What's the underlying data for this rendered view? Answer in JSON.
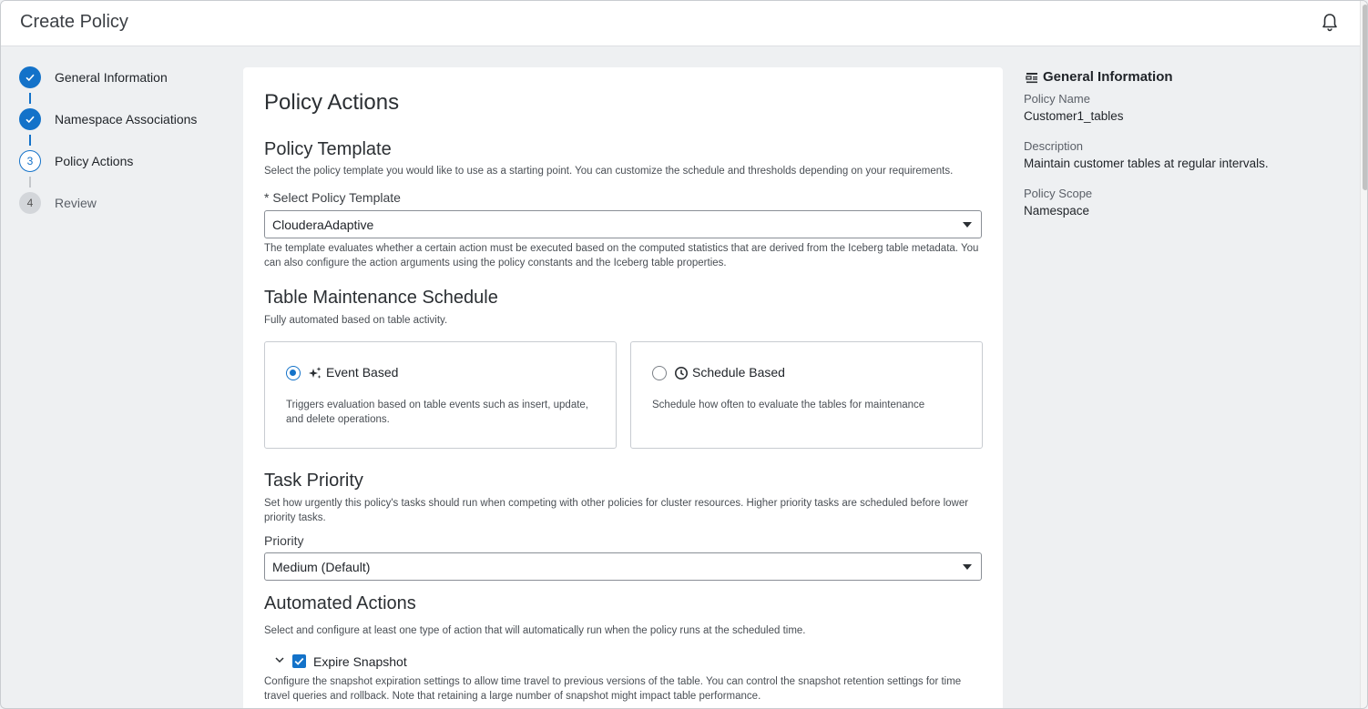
{
  "header": {
    "title": "Create Policy",
    "icons": [
      "bell-icon"
    ]
  },
  "stepper": {
    "steps": [
      {
        "number": "1",
        "label": "General Information",
        "state": "done"
      },
      {
        "number": "2",
        "label": "Namespace Associations",
        "state": "done"
      },
      {
        "number": "3",
        "label": "Policy Actions",
        "state": "active"
      },
      {
        "number": "4",
        "label": "Review",
        "state": "todo"
      }
    ]
  },
  "main": {
    "title": "Policy Actions",
    "template": {
      "heading": "Policy Template",
      "description": "Select the policy template you would like to use as a starting point. You can customize the schedule and thresholds depending on your requirements.",
      "required_marker": "*",
      "field_label": "Select Policy Template",
      "value": "ClouderaAdaptive",
      "help": "The template evaluates whether a certain action must be executed based on the computed statistics that are derived from the Iceberg table metadata. You can also configure the action arguments using the policy constants and the Iceberg table properties."
    },
    "schedule": {
      "heading": "Table Maintenance Schedule",
      "description": "Fully automated based on table activity.",
      "options": [
        {
          "title": "Event Based",
          "icon": "sparkle-icon",
          "selected": true,
          "description": "Triggers evaluation based on table events such as insert, update, and delete operations."
        },
        {
          "title": "Schedule Based",
          "icon": "clock-icon",
          "selected": false,
          "description": "Schedule how often to evaluate the tables for maintenance"
        }
      ]
    },
    "priority": {
      "heading": "Task Priority",
      "description": "Set how urgently this policy's tasks should run when competing with other policies for cluster resources. Higher priority tasks are scheduled before lower priority tasks.",
      "field_label": "Priority",
      "value": "Medium (Default)"
    },
    "automated": {
      "heading": "Automated Actions",
      "description": "Select and configure at least one type of action that will automatically run when the policy runs at the scheduled time.",
      "expire": {
        "label": "Expire Snapshot",
        "checked": true,
        "description": "Configure the snapshot expiration settings to allow time travel to previous versions of the table. You can control the snapshot retention settings for time travel queries and rollback. Note that retaining a large number of snapshot might impact table performance."
      }
    }
  },
  "summary": {
    "heading": "General Information",
    "icon": "summary-grid-icon",
    "fields": [
      {
        "label": "Policy Name",
        "value": "Customer1_tables"
      },
      {
        "label": "Description",
        "value": "Maintain customer tables at regular intervals."
      },
      {
        "label": "Policy Scope",
        "value": "Namespace"
      }
    ]
  },
  "colors": {
    "accent": "#1372c9",
    "background": "#eef0f2",
    "card": "#ffffff"
  }
}
